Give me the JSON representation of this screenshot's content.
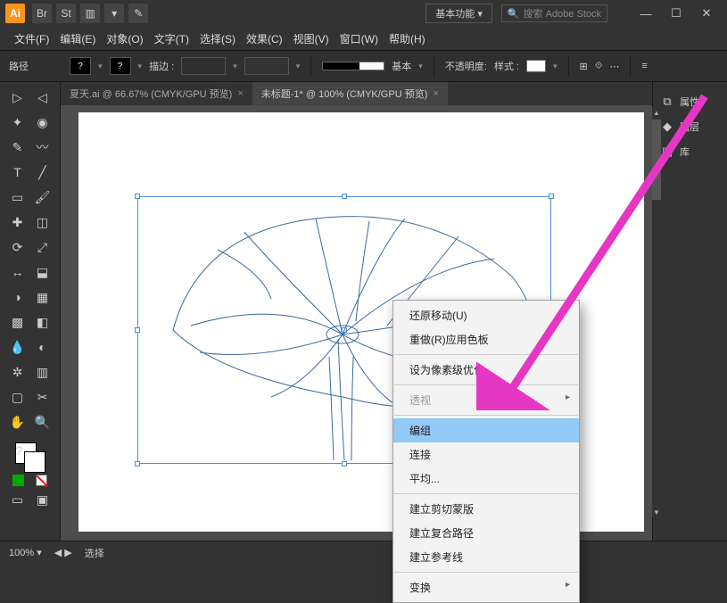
{
  "workspace_label": "基本功能",
  "stock_placeholder": "搜索 Adobe Stock",
  "menus": {
    "file": "文件(F)",
    "edit": "编辑(E)",
    "object": "对象(O)",
    "type": "文字(T)",
    "select": "选择(S)",
    "effect": "效果(C)",
    "view": "视图(V)",
    "window": "窗口(W)",
    "help": "帮助(H)"
  },
  "control": {
    "entity": "路径",
    "stroke_label": "描边 :",
    "stroke_value": "",
    "style_label": "基本",
    "opacity_label": "不透明度:",
    "style2": "样式 :"
  },
  "tabs": [
    {
      "label": "夏天.ai @ 66.67% (CMYK/GPU 预览)",
      "active": false
    },
    {
      "label": "未标题-1* @ 100% (CMYK/GPU 预览)",
      "active": true
    }
  ],
  "right_panel": {
    "properties": "属性",
    "layers": "图层",
    "libraries": "库"
  },
  "context_menu": {
    "undo": "还原移动(U)",
    "redo": "重做(R)应用色板",
    "pixel": "设为像素级优化",
    "perspective": "透视",
    "group": "编组",
    "join": "连接",
    "average": "平均...",
    "clip": "建立剪切蒙版",
    "compound": "建立复合路径",
    "guides": "建立参考线",
    "transform": "变换"
  },
  "status": {
    "zoom": "100%",
    "sel": "选择"
  }
}
